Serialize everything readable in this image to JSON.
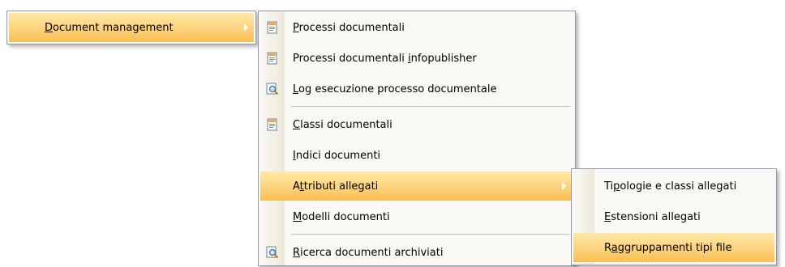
{
  "menu_level1": {
    "items": [
      {
        "pre": "",
        "ul": "D",
        "post": "ocument management",
        "has_submenu": true
      }
    ]
  },
  "menu_level2": {
    "items": [
      {
        "pre": "",
        "ul": "P",
        "post": "rocessi documentali",
        "icon": "document-process-icon"
      },
      {
        "pre": "Processi documentali ",
        "ul": "i",
        "post": "nfopublisher",
        "icon": "document-process-icon"
      },
      {
        "pre": "",
        "ul": "L",
        "post": "og esecuzione processo documentale",
        "icon": "log-search-icon"
      },
      {
        "pre": "",
        "ul": "C",
        "post": "lassi documentali",
        "icon": "document-process-icon"
      },
      {
        "pre": "",
        "ul": "I",
        "post": "ndici documenti",
        "icon": ""
      },
      {
        "pre": "A",
        "ul": "t",
        "post": "tributi allegati",
        "icon": "",
        "has_submenu": true
      },
      {
        "pre": "",
        "ul": "M",
        "post": "odelli documenti",
        "icon": ""
      },
      {
        "pre": "",
        "ul": "R",
        "post": "icerca documenti archiviati",
        "icon": "log-search-icon"
      }
    ]
  },
  "menu_level3": {
    "items": [
      {
        "pre": "Ti",
        "ul": "p",
        "post": "ologie e classi allegati"
      },
      {
        "pre": "",
        "ul": "E",
        "post": "stensioni allegati"
      },
      {
        "pre": "R",
        "ul": "a",
        "post": "ggruppamenti tipi file"
      }
    ]
  },
  "colors": {
    "highlight_top": "#ffe9a6",
    "highlight_bottom": "#f8bf53",
    "menu_background": "#f9f8f4",
    "menu_border": "#8a9ab5"
  }
}
